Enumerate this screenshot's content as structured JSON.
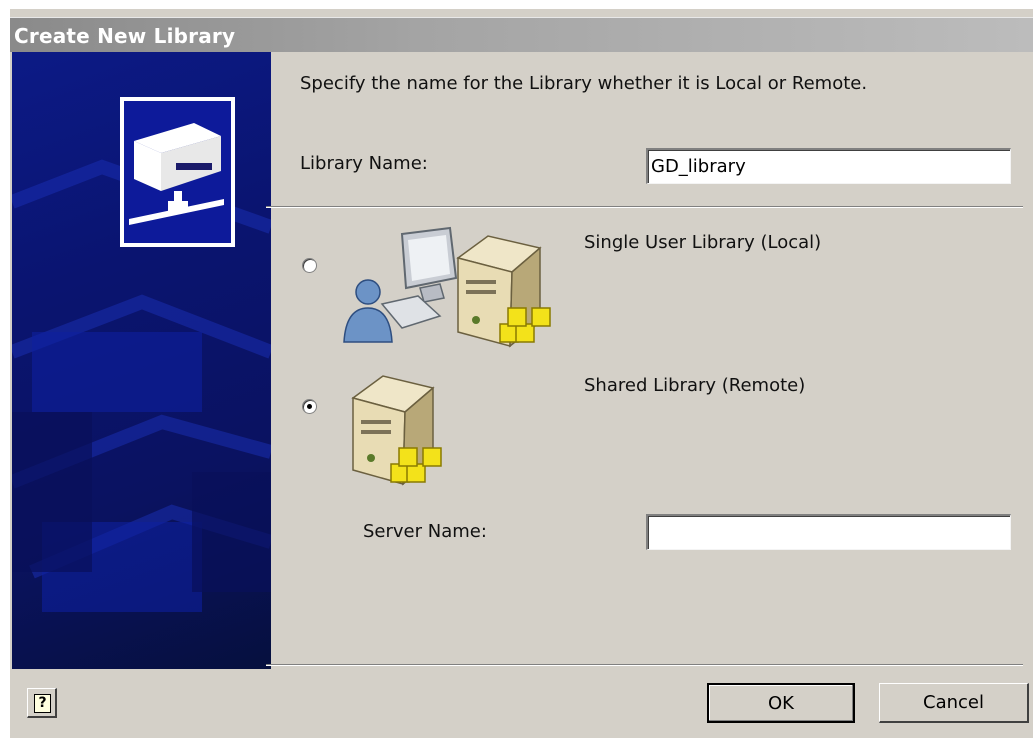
{
  "dialog": {
    "title": "Create New Library",
    "instruction": "Specify the name for the Library whether it is Local or Remote."
  },
  "library_name": {
    "label": "Library Name:",
    "value": "GD_library"
  },
  "options": [
    {
      "label": "Single User Library (Local)",
      "selected": false
    },
    {
      "label": "Shared Library (Remote)",
      "selected": true
    }
  ],
  "server_name": {
    "label": "Server Name:",
    "value": ""
  },
  "buttons": {
    "help": "?",
    "ok": "OK",
    "cancel": "Cancel"
  },
  "icons": {
    "banner": "library-server-icon",
    "local": "user-computer-server-icon",
    "remote": "server-icon"
  }
}
